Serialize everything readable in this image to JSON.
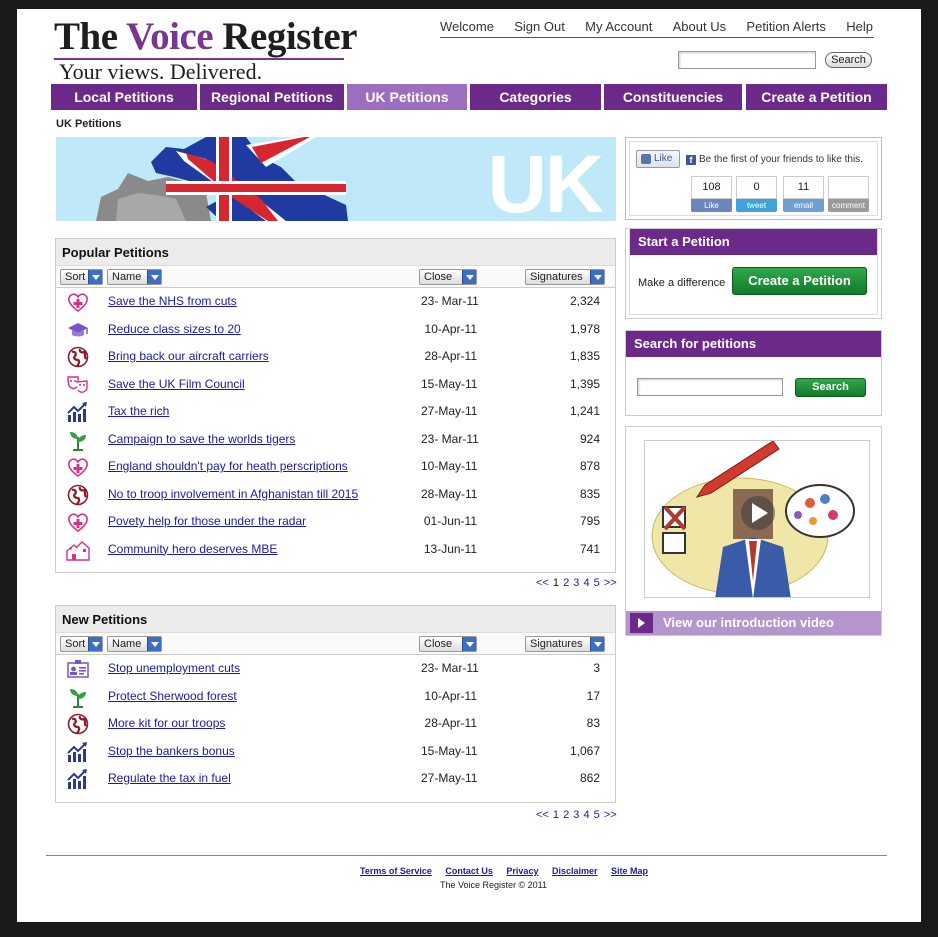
{
  "brand": {
    "title_part1": "The ",
    "title_accent": "Voice",
    "title_part2": " Register",
    "tagline": "Your views. Delivered."
  },
  "topnav": [
    "Welcome",
    "Sign Out",
    "My Account",
    "About Us",
    "Petition Alerts",
    "Help"
  ],
  "header_search": {
    "button": "Search"
  },
  "mainnav": [
    "Local Petitions",
    "Regional Petitions",
    "UK Petitions",
    "Categories",
    "Constituencies",
    "Create a Petition"
  ],
  "breadcrumb": "UK Petitions",
  "banner_text": "UK",
  "columns": {
    "sort": "Sort",
    "name": "Name",
    "close": "Close",
    "signatures": "Signatures"
  },
  "popular": {
    "title": "Popular Petitions",
    "rows": [
      {
        "icon": "health-heart-icon",
        "name": "Save the NHS from cuts",
        "date": "23- Mar-11",
        "sigs": "2,324"
      },
      {
        "icon": "graduation-cap-icon",
        "name": "Reduce class sizes to 20",
        "date": "10-Apr-11",
        "sigs": "1,978"
      },
      {
        "icon": "globe-icon",
        "name": "Bring back our aircraft carriers",
        "date": "28-Apr-11",
        "sigs": "1,835"
      },
      {
        "icon": "theatre-masks-icon",
        "name": "Save the UK Film Council",
        "date": "15-May-11",
        "sigs": "1,395"
      },
      {
        "icon": "rising-chart-icon",
        "name": "Tax the rich",
        "date": "27-May-11",
        "sigs": "1,241"
      },
      {
        "icon": "seedling-icon",
        "name": "Campaign to save the worlds tigers",
        "date": "23- Mar-11",
        "sigs": "924"
      },
      {
        "icon": "health-heart-icon",
        "name": "England shouldn't pay for heath perscriptions",
        "date": "10-May-11",
        "sigs": "878"
      },
      {
        "icon": "globe-icon",
        "name": "No to troop involvement in Afghanistan till 2015",
        "date": "28-May-11",
        "sigs": "835"
      },
      {
        "icon": "health-heart-icon",
        "name": "Povety help for those under the radar",
        "date": "01-Jun-11",
        "sigs": "795"
      },
      {
        "icon": "houses-icon",
        "name": "Community hero deserves MBE",
        "date": "13-Jun-11",
        "sigs": "741"
      }
    ]
  },
  "newp": {
    "title": "New Petitions",
    "rows": [
      {
        "icon": "id-card-icon",
        "name": "Stop unemployment cuts",
        "date": "23- Mar-11",
        "sigs": "3"
      },
      {
        "icon": "seedling-icon",
        "name": "Protect Sherwood forest",
        "date": "10-Apr-11",
        "sigs": "17"
      },
      {
        "icon": "globe-icon",
        "name": "More kit for our troops",
        "date": "28-Apr-11",
        "sigs": "83"
      },
      {
        "icon": "rising-chart-icon",
        "name": "Stop the bankers bonus",
        "date": "15-May-11",
        "sigs": "1,067"
      },
      {
        "icon": "rising-chart-icon",
        "name": "Regulate the tax in fuel",
        "date": "27-May-11",
        "sigs": "862"
      }
    ]
  },
  "pager": {
    "prev": "<<",
    "pages": [
      "1",
      "2",
      "3",
      "4",
      "5"
    ],
    "next": ">>",
    "current": "1"
  },
  "social": {
    "like": "Like",
    "friends_text": "Be the first of your friends to like this.",
    "counts": [
      {
        "num": "108",
        "label": "Like",
        "color": "#6a86bd"
      },
      {
        "num": "0",
        "label": "tweet",
        "color": "#3fa2d8"
      },
      {
        "num": "11",
        "label": "email",
        "color": "#6e9fd3"
      },
      {
        "num": "",
        "label": "comment",
        "color": "#9a9a9a"
      }
    ]
  },
  "start_petition": {
    "title": "Start a Petition",
    "text": "Make a difference",
    "button": "Create a Petition"
  },
  "search_petitions": {
    "title": "Search for petitions",
    "button": "Search"
  },
  "video": {
    "label": "View our introduction video"
  },
  "footer": {
    "links": [
      "Terms of Service",
      "Contact Us",
      "Privacy",
      "Disclaimer",
      "Site Map"
    ],
    "copyright": "The Voice Register © 2011"
  },
  "colors": {
    "brand_purple": "#6b2a8a",
    "active_tab": "#9d6ec0",
    "link_blue": "#1a1aa8",
    "green_button": "#1f8f3a"
  }
}
